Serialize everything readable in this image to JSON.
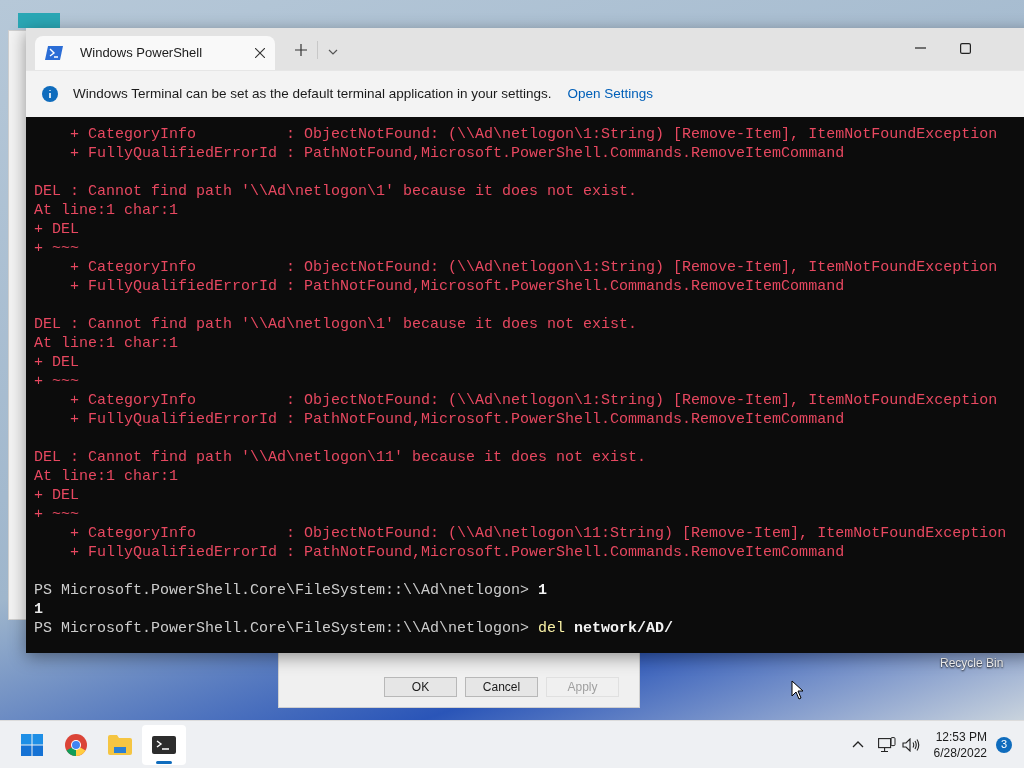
{
  "window": {
    "tabs": [
      {
        "title": "Windows PowerShell",
        "selected": true
      }
    ],
    "infobar": {
      "message": "Windows Terminal can be set as the default terminal application in your settings.",
      "link": "Open Settings"
    }
  },
  "terminal": {
    "lines": [
      {
        "kind": "error",
        "text": "    + CategoryInfo          : ObjectNotFound: (\\\\Ad\\netlogon\\1:String) [Remove-Item], ItemNotFoundException"
      },
      {
        "kind": "error",
        "text": "    + FullyQualifiedErrorId : PathNotFound,Microsoft.PowerShell.Commands.RemoveItemCommand"
      },
      {
        "kind": "blank"
      },
      {
        "kind": "error",
        "text": "DEL : Cannot find path '\\\\Ad\\netlogon\\1' because it does not exist."
      },
      {
        "kind": "error",
        "text": "At line:1 char:1"
      },
      {
        "kind": "error",
        "text": "+ DEL"
      },
      {
        "kind": "error",
        "text": "+ ~~~"
      },
      {
        "kind": "error",
        "text": "    + CategoryInfo          : ObjectNotFound: (\\\\Ad\\netlogon\\1:String) [Remove-Item], ItemNotFoundException"
      },
      {
        "kind": "error",
        "text": "    + FullyQualifiedErrorId : PathNotFound,Microsoft.PowerShell.Commands.RemoveItemCommand"
      },
      {
        "kind": "blank"
      },
      {
        "kind": "error",
        "text": "DEL : Cannot find path '\\\\Ad\\netlogon\\1' because it does not exist."
      },
      {
        "kind": "error",
        "text": "At line:1 char:1"
      },
      {
        "kind": "error",
        "text": "+ DEL"
      },
      {
        "kind": "error",
        "text": "+ ~~~"
      },
      {
        "kind": "error",
        "text": "    + CategoryInfo          : ObjectNotFound: (\\\\Ad\\netlogon\\1:String) [Remove-Item], ItemNotFoundException"
      },
      {
        "kind": "error",
        "text": "    + FullyQualifiedErrorId : PathNotFound,Microsoft.PowerShell.Commands.RemoveItemCommand"
      },
      {
        "kind": "blank"
      },
      {
        "kind": "error",
        "text": "DEL : Cannot find path '\\\\Ad\\netlogon\\11' because it does not exist."
      },
      {
        "kind": "error",
        "text": "At line:1 char:1"
      },
      {
        "kind": "error",
        "text": "+ DEL"
      },
      {
        "kind": "error",
        "text": "+ ~~~"
      },
      {
        "kind": "error",
        "text": "    + CategoryInfo          : ObjectNotFound: (\\\\Ad\\netlogon\\11:String) [Remove-Item], ItemNotFoundException"
      },
      {
        "kind": "error",
        "text": "    + FullyQualifiedErrorId : PathNotFound,Microsoft.PowerShell.Commands.RemoveItemCommand"
      },
      {
        "kind": "blank"
      },
      {
        "kind": "prompt",
        "prompt": "PS Microsoft.PowerShell.Core\\FileSystem::\\\\Ad\\netlogon>",
        "tokens": [
          {
            "kind": "argument",
            "text": "1"
          }
        ]
      },
      {
        "kind": "output",
        "text": "1"
      },
      {
        "kind": "prompt",
        "prompt": "PS Microsoft.PowerShell.Core\\FileSystem::\\\\Ad\\netlogon>",
        "tokens": [
          {
            "kind": "command",
            "text": "del"
          },
          {
            "kind": "argument",
            "text": "network/AD/"
          }
        ]
      }
    ]
  },
  "background_dialog": {
    "buttons": [
      {
        "label": "OK",
        "disabled": false
      },
      {
        "label": "Cancel",
        "disabled": false
      },
      {
        "label": "Apply",
        "disabled": true
      }
    ]
  },
  "desktop": {
    "icon_label": "Recycle Bin"
  },
  "taskbar": {
    "apps": [
      {
        "kind": "start",
        "selected": false
      },
      {
        "kind": "browser",
        "selected": false
      },
      {
        "kind": "folder",
        "selected": false
      },
      {
        "kind": "terminal",
        "selected": true
      }
    ],
    "clock": {
      "time": "12:53 PM",
      "date": "6/28/2022"
    },
    "notifications": "3"
  }
}
